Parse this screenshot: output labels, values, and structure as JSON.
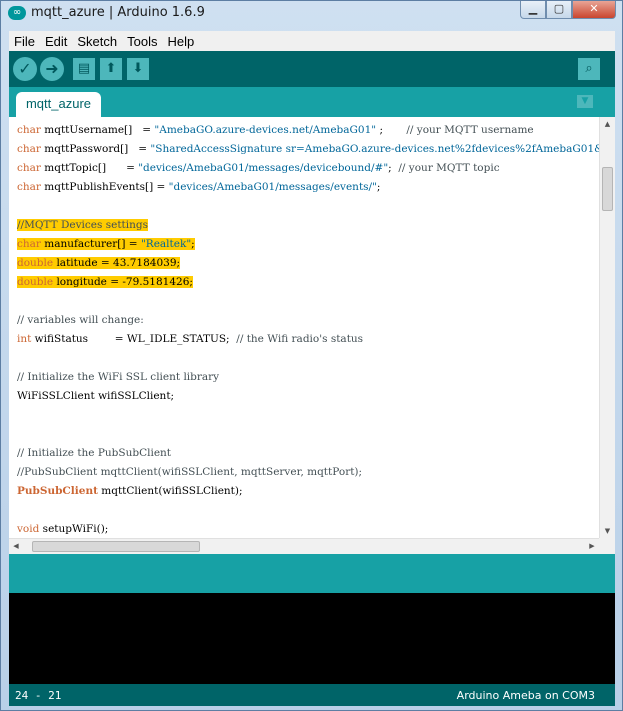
{
  "window": {
    "title": "mqtt_azure | Arduino 1.6.9",
    "icon": "arduino-logo-icon",
    "buttons": {
      "minimize": "▁",
      "maximize": "▢",
      "close": "✕"
    }
  },
  "menu": [
    "File",
    "Edit",
    "Sketch",
    "Tools",
    "Help"
  ],
  "toolbar": {
    "verify_icon": "✓",
    "upload_icon": "➜",
    "new_icon": "▤",
    "open_icon": "⬆",
    "save_icon": "⬇",
    "serial_monitor_icon": "⌕"
  },
  "tabs": [
    {
      "label": "mqtt_azure",
      "active": true
    }
  ],
  "tab_menu_icon": "▼",
  "colors": {
    "toolbar": "#006468",
    "tabbar": "#17a1a5",
    "highlight": "#ffcc00",
    "keyword": "#cc6633",
    "string": "#006699"
  },
  "code": {
    "lines": [
      [
        {
          "t": "char",
          "c": "kw"
        },
        {
          "t": " mqttUsername[]   = "
        },
        {
          "t": "\"AmebaGO.azure-devices.net/AmebaG01\"",
          "c": "str"
        },
        {
          "t": " ;       "
        },
        {
          "t": "// your MQTT username",
          "c": "cm"
        }
      ],
      [
        {
          "t": "char",
          "c": "kw"
        },
        {
          "t": " mqttPassword[]   = "
        },
        {
          "t": "\"SharedAccessSignature sr=AmebaGO.azure-devices.net%2fdevices%2fAmebaG01&",
          "c": "str"
        }
      ],
      [
        {
          "t": "char",
          "c": "kw"
        },
        {
          "t": " mqttTopic[]      = "
        },
        {
          "t": "\"devices/AmebaG01/messages/devicebound/#\"",
          "c": "str"
        },
        {
          "t": ";  "
        },
        {
          "t": "// your MQTT topic",
          "c": "cm"
        }
      ],
      [
        {
          "t": "char",
          "c": "kw"
        },
        {
          "t": " mqttPublishEvents[] = "
        },
        {
          "t": "\"devices/AmebaG01/messages/events/\"",
          "c": "str"
        },
        {
          "t": ";"
        }
      ],
      [],
      [
        {
          "t": "//MQTT Devices settings",
          "c": "cm",
          "h": 1
        }
      ],
      [
        {
          "t": "char",
          "c": "kw",
          "h": 1
        },
        {
          "t": " manufacturer[] = ",
          "h": 1
        },
        {
          "t": "\"Realtek\"",
          "c": "str",
          "h": 1
        },
        {
          "t": ";",
          "h": 1
        }
      ],
      [
        {
          "t": "double",
          "c": "kw",
          "h": 1
        },
        {
          "t": " latitude = 43.7184039;",
          "h": 1
        }
      ],
      [
        {
          "t": "double",
          "c": "kw",
          "h": 1
        },
        {
          "t": " longitude = -79.5181426;",
          "h": 1
        }
      ],
      [],
      [
        {
          "t": "// variables will change:",
          "c": "cm"
        }
      ],
      [
        {
          "t": "int",
          "c": "kw"
        },
        {
          "t": " wifiStatus        = WL_IDLE_STATUS;  "
        },
        {
          "t": "// the Wifi radio's status",
          "c": "cm"
        }
      ],
      [],
      [
        {
          "t": "// Initialize the WiFi SSL client library",
          "c": "cm"
        }
      ],
      [
        {
          "t": "WiFiSSLClient wifiSSLClient;"
        }
      ],
      [],
      [],
      [
        {
          "t": "// Initialize the PubSubClient",
          "c": "cm"
        }
      ],
      [
        {
          "t": "//PubSubClient mqttClient(wifiSSLClient, mqttServer, mqttPort);",
          "c": "cm"
        }
      ],
      [
        {
          "t": "PubSubClient",
          "c": "cls"
        },
        {
          "t": " mqttClient(wifiSSLClient);"
        }
      ],
      [],
      [
        {
          "t": "void",
          "c": "kw"
        },
        {
          "t": " setupWiFi();"
        }
      ]
    ]
  },
  "scroll": {
    "up_icon": "▲",
    "down_icon": "▼",
    "left_icon": "◀",
    "right_icon": "▶"
  },
  "status": {
    "line_col": "24 - 21",
    "board": "Arduino Ameba on COM3"
  }
}
